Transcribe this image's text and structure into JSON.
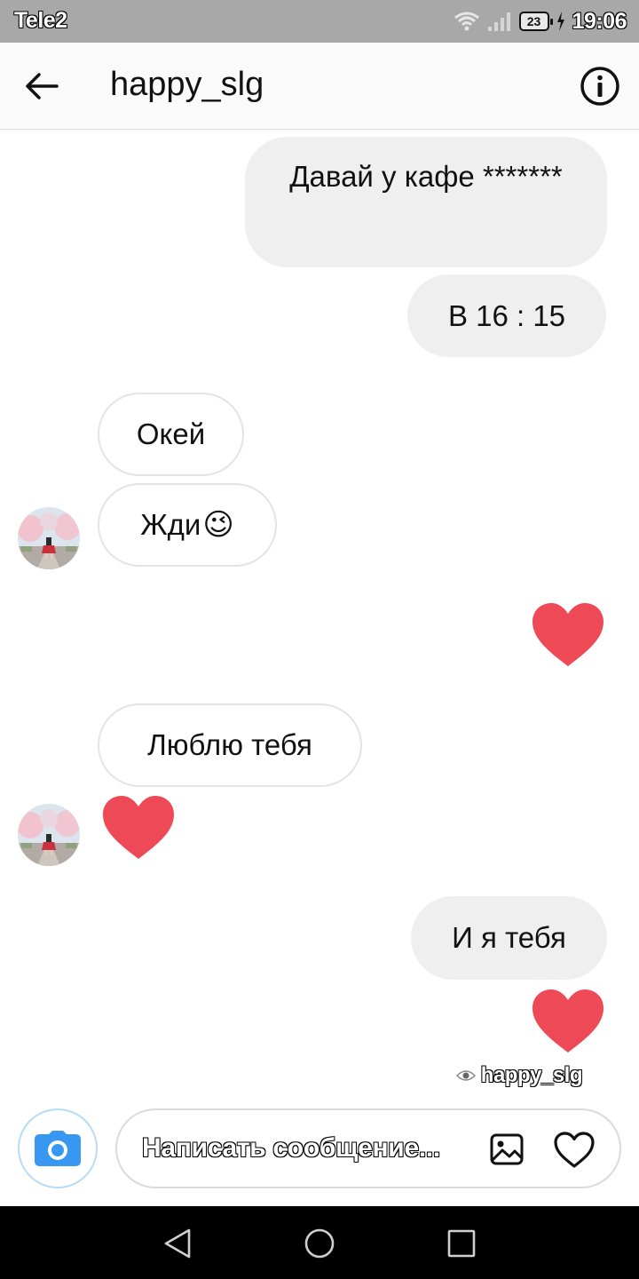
{
  "status_bar": {
    "carrier": "Tele2",
    "battery": "23",
    "time": "19:06",
    "icons": [
      "wifi-icon",
      "signal-icon",
      "battery-icon",
      "charging-icon"
    ]
  },
  "header": {
    "title": "happy_slg",
    "back_icon": "arrow-left-icon",
    "info_icon": "info-icon"
  },
  "messages": [
    {
      "direction": "outgoing",
      "text": "Давай у кафе *******"
    },
    {
      "direction": "outgoing",
      "text": "В 16 : 15"
    },
    {
      "direction": "incoming",
      "text": "Окей"
    },
    {
      "direction": "incoming",
      "text": "Жди",
      "emoji": "😉"
    },
    {
      "direction": "outgoing",
      "type": "heart"
    },
    {
      "direction": "incoming",
      "text": "Люблю тебя"
    },
    {
      "direction": "incoming",
      "type": "heart"
    },
    {
      "direction": "outgoing",
      "text": "И я тебя"
    },
    {
      "direction": "outgoing",
      "type": "heart"
    }
  ],
  "seen": {
    "icon": "eye-icon",
    "name": "happy_slg"
  },
  "composer": {
    "placeholder": "Написать сообщение...",
    "camera_icon": "camera-icon",
    "gallery_icon": "image-icon",
    "like_icon": "heart-outline-icon"
  },
  "navigation": [
    "back-triangle-icon",
    "home-circle-icon",
    "recent-square-icon"
  ],
  "colors": {
    "heart": "#ed4956",
    "outgoing_bubble": "#efefef",
    "camera_accent": "#3897f0",
    "status_bar": "#a8a8a8"
  }
}
